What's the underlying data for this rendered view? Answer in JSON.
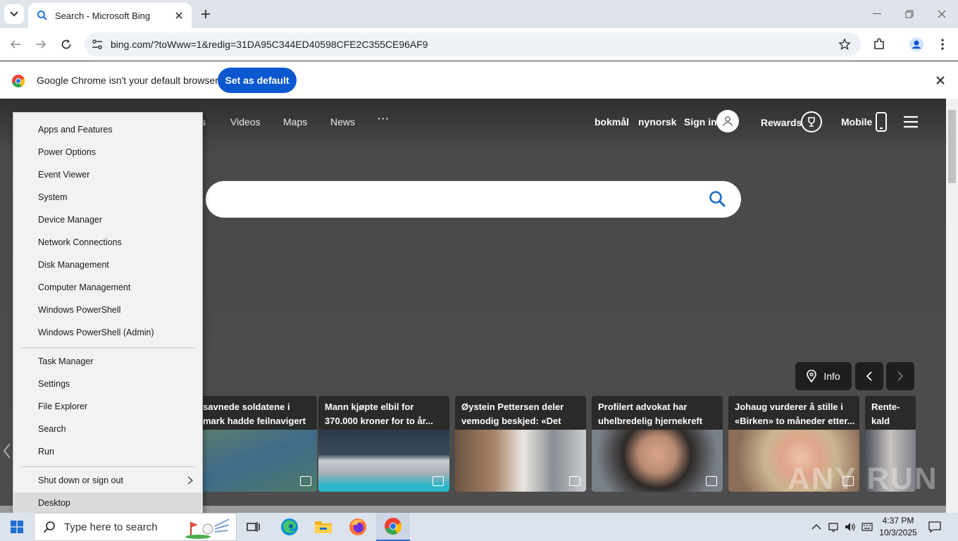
{
  "browser": {
    "tab_title": "Search - Microsoft Bing",
    "url": "bing.com/?toWww=1&redig=31DA95C344ED40598CFE2C355CE96AF9"
  },
  "infobar": {
    "message": "Google Chrome isn't your default browser",
    "set_default_label": "Set as default"
  },
  "bing": {
    "nav": [
      "s",
      "Videos",
      "Maps",
      "News",
      "···"
    ],
    "lang1": "bokmål",
    "lang2": "nynorsk",
    "sign_in": "Sign in",
    "rewards": "Rewards",
    "mobile": "Mobile",
    "info_label": "Info",
    "news": [
      {
        "headline": "savnede soldatene i\nmark hadde feilnavigert"
      },
      {
        "headline": "Mann kjøpte elbil for\n370.000 kroner for to år..."
      },
      {
        "headline": "Øystein Pettersen deler\nvemodig beskjed: «Det gjø..."
      },
      {
        "headline": "Profilert advokat har\nuhelbredelig hjernekreft"
      },
      {
        "headline": "Johaug vurderer å stille i\n«Birken» to måneder etter..."
      },
      {
        "headline": "Rente-kald\nbeskjed"
      }
    ]
  },
  "context_menu": {
    "items_group1": [
      "Apps and Features",
      "Power Options",
      "Event Viewer",
      "System",
      "Device Manager",
      "Network Connections",
      "Disk Management",
      "Computer Management",
      "Windows PowerShell",
      "Windows PowerShell (Admin)"
    ],
    "items_group2": [
      "Task Manager",
      "Settings",
      "File Explorer",
      "Search",
      "Run"
    ],
    "shutdown": "Shut down or sign out",
    "desktop": "Desktop"
  },
  "taskbar": {
    "search_placeholder": "Type here to search",
    "time": "4:37 PM",
    "date": "10/3/2025"
  },
  "watermark": "ANY RUN"
}
